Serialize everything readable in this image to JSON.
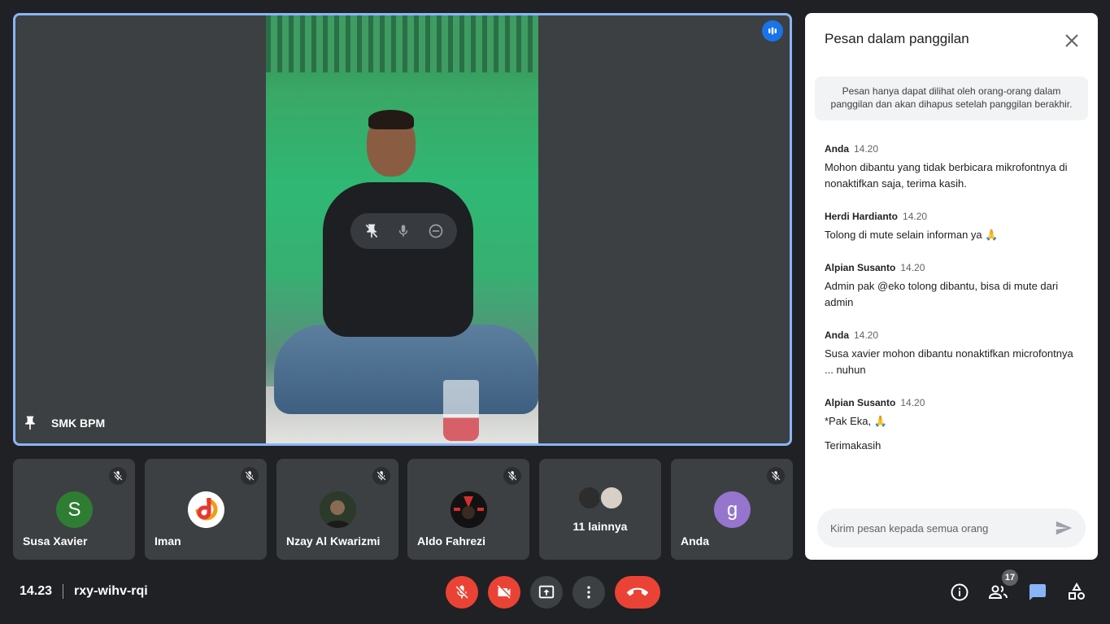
{
  "main_stage": {
    "participant_name": "SMK BPM"
  },
  "tiles": [
    {
      "name": "Susa Xavier",
      "initial": "S",
      "avatar_color": "#2e7d32"
    },
    {
      "name": "Iman"
    },
    {
      "name": "Nzay Al Kwarizmi"
    },
    {
      "name": "Aldo Fahrezi"
    },
    {
      "others_label": "11 lainnya"
    },
    {
      "name": "Anda",
      "initial": "g",
      "avatar_color": "#9575cd"
    }
  ],
  "chat": {
    "title": "Pesan dalam panggilan",
    "notice": "Pesan hanya dapat dilihat oleh orang-orang dalam panggilan dan akan dihapus setelah panggilan berakhir.",
    "messages": [
      {
        "sender": "Anda",
        "time": "14.20",
        "lines": [
          "Mohon dibantu yang tidak berbicara mikrofontnya di nonaktifkan saja, terima kasih."
        ]
      },
      {
        "sender": "Herdi Hardianto",
        "time": "14.20",
        "lines": [
          "Tolong di mute selain informan ya 🙏"
        ]
      },
      {
        "sender": "Alpian Susanto",
        "time": "14.20",
        "lines": [
          "Admin pak @eko tolong dibantu, bisa di mute dari admin"
        ]
      },
      {
        "sender": "Anda",
        "time": "14.20",
        "lines": [
          "Susa xavier mohon dibantu nonaktifkan microfontnya ... nuhun"
        ]
      },
      {
        "sender": "Alpian Susanto",
        "time": "14.20",
        "lines": [
          "*Pak Eka, 🙏",
          "Terimakasih"
        ]
      }
    ],
    "input_placeholder": "Kirim pesan kepada semua orang"
  },
  "bottom_bar": {
    "time": "14.23",
    "meeting_code": "rxy-wihv-rqi",
    "participants_count": "17"
  },
  "colors": {
    "accent_blue": "#8ab4f8",
    "danger_red": "#ea4335",
    "panel_bg": "#3c4043"
  }
}
